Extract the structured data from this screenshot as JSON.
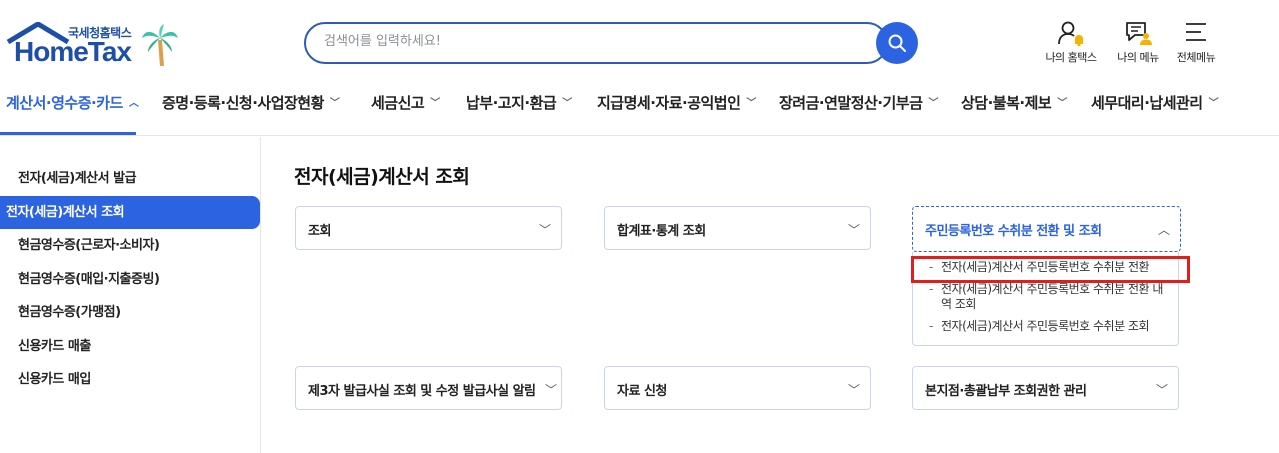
{
  "logo": {
    "sub": "국세청홈택스",
    "main": "HomeTax"
  },
  "search": {
    "placeholder": "검색어를 입력하세요!"
  },
  "utils": [
    {
      "label": "나의 홈택스",
      "icon": "user-bell-icon"
    },
    {
      "label": "나의 메뉴",
      "icon": "my-menu-icon"
    },
    {
      "label": "전체메뉴",
      "icon": "hamburger-icon"
    }
  ],
  "gnb": [
    {
      "label": "계산서·영수증·카드",
      "active": true
    },
    {
      "label": "증명·등록·신청·사업장현황"
    },
    {
      "label": "세금신고"
    },
    {
      "label": "납부·고지·환급"
    },
    {
      "label": "지급명세·자료·공익법인"
    },
    {
      "label": "장려금·연말정산·기부금"
    },
    {
      "label": "상담·불복·제보"
    },
    {
      "label": "세무대리·납세관리"
    }
  ],
  "sidebar": {
    "items": [
      {
        "label": "전자(세금)계산서 발급"
      },
      {
        "label": "전자(세금)계산서 조회",
        "active": true
      },
      {
        "label": "현금영수증(근로자·소비자)"
      },
      {
        "label": "현금영수증(매입·지출증빙)"
      },
      {
        "label": "현금영수증(가맹점)"
      },
      {
        "label": "신용카드 매출"
      },
      {
        "label": "신용카드 매입"
      }
    ]
  },
  "main": {
    "title": "전자(세금)계산서 조회",
    "cards": [
      {
        "label": "조회"
      },
      {
        "label": "합계표·통계 조회"
      },
      {
        "label": "주민등록번호 수취분 전환 및 조회",
        "open": true
      },
      {
        "label": "제3자 발급사실 조회 및 수정 발급사실 알림"
      },
      {
        "label": "자료 신청"
      },
      {
        "label": "본지점·총괄납부 조회권한 관리"
      }
    ],
    "submenu": [
      {
        "label": "전자(세금)계산서 주민등록번호 수취분 전환",
        "highlighted": true
      },
      {
        "label": "전자(세금)계산서 주민등록번호 수취분 전환 내역 조회"
      },
      {
        "label": "전자(세금)계산서 주민등록번호 수취분 조회"
      }
    ]
  },
  "colors": {
    "accent": "#2b63e0",
    "highlight": "#e01e1e",
    "brand": "#1d4fa8"
  }
}
